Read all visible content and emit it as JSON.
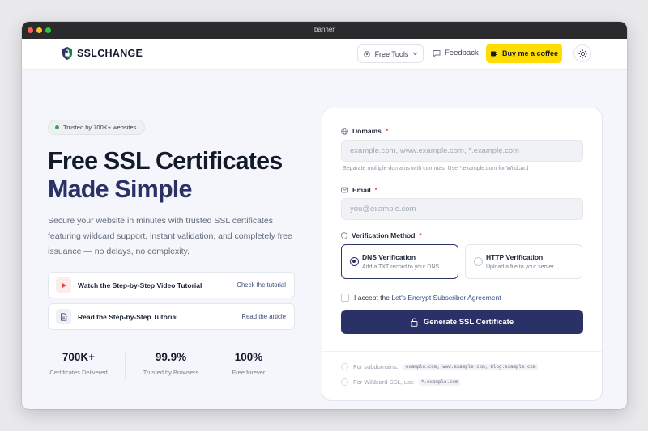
{
  "window": {
    "title": "banner"
  },
  "nav": {
    "brand": "SSLCHANGE",
    "tools_label": "Free Tools",
    "feedback_label": "Feedback",
    "coffee_label": "Buy me a coffee",
    "accent": "#ffdd00"
  },
  "hero": {
    "badge": "Trusted by 700K+ websites",
    "title_line1": "Free SSL Certificates",
    "title_line2": "Made Simple",
    "subtitle": "Secure your website in minutes with trusted SSL certificates featuring wildcard support, instant validation, and completely free issuance — no delays, no complexity.",
    "tutorials": [
      {
        "label": "Watch the Step-by-Step Video Tutorial",
        "link": "Check the tutorial",
        "icon": "play-icon"
      },
      {
        "label": "Read the Step-by-Step Tutorial",
        "link": "Read the article",
        "icon": "document-icon"
      }
    ],
    "stats": [
      {
        "value": "700K+",
        "label": "Certificates Delivered"
      },
      {
        "value": "99.9%",
        "label": "Trusted by Browsers"
      },
      {
        "value": "100%",
        "label": "Free forever"
      }
    ]
  },
  "form": {
    "domains_label": "Domains",
    "domains_placeholder": "example.com, www.example.com, *.example.com",
    "domains_hint": "Separate multiple domains with commas. Use *.example.com for Wildcard",
    "email_label": "Email",
    "email_placeholder": "you@example.com",
    "method_label": "Verification Method",
    "methods": [
      {
        "title": "DNS Verification",
        "desc": "Add a TXT record to your DNS",
        "selected": true
      },
      {
        "title": "HTTP Verification",
        "desc": "Upload a file to your server",
        "selected": false
      }
    ],
    "agree_prefix": "I accept the",
    "agree_link": "Let's Encrypt Subscriber Agreement",
    "generate_label": "Generate SSL Certificate",
    "primary_color": "#2a3166",
    "tips": [
      {
        "text": "For subdomains:",
        "code": "example.com, www.example.com, blog.example.com"
      },
      {
        "text": "For Wildcard SSL, use",
        "code": "*.example.com"
      }
    ]
  }
}
